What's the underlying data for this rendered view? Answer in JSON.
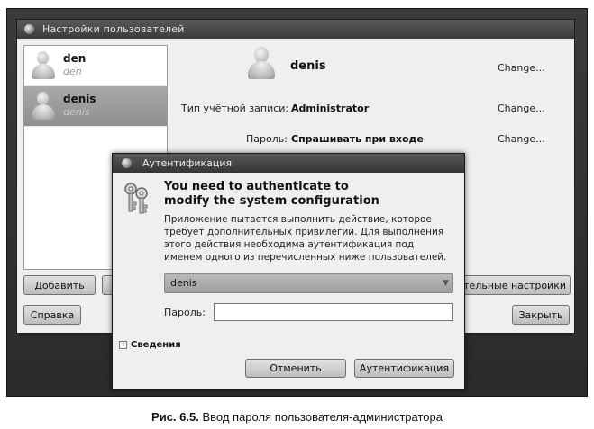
{
  "window": {
    "title": "Настройки пользователей"
  },
  "users": [
    {
      "name": "den",
      "login": "den",
      "selected": false
    },
    {
      "name": "denis",
      "login": "denis",
      "selected": true
    }
  ],
  "details": {
    "display_name": "denis",
    "change_label": "Change...",
    "account_type_label": "Тип учётной записи:",
    "account_type_value": "Administrator",
    "password_label": "Пароль:",
    "password_value": "Спрашивать при входе"
  },
  "buttons": {
    "add": "Добавить",
    "advanced": "тельные настройки",
    "help": "Справка",
    "close": "Закрыть"
  },
  "auth_dialog": {
    "title": "Аутентификация",
    "heading_line1": "You need to authenticate to",
    "heading_line2": "modify the system configuration",
    "message_lines": [
      "Приложение пытается выполнить действие, которое",
      "требует дополнительных привилегий. Для выполнения",
      "этого действия необходима аутентификация под",
      "именем одного из перечисленных ниже пользователей."
    ],
    "selected_user": "denis",
    "password_label": "Пароль:",
    "password_value": "",
    "details_label": "Сведения",
    "cancel_button": "Отменить",
    "authenticate_button": "Аутентификация"
  },
  "caption": {
    "figure": "Рис. 6.5.",
    "text": " Ввод пароля пользователя-администратора"
  }
}
